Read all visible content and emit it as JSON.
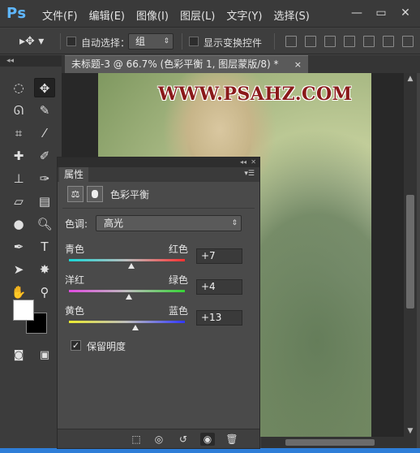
{
  "app": {
    "logo": "Ps"
  },
  "menu": [
    "文件(F)",
    "编辑(E)",
    "图像(I)",
    "图层(L)",
    "文字(Y)",
    "选择(S)"
  ],
  "window_controls": {
    "minimize": "—",
    "restore": "▭",
    "close": "✕"
  },
  "options_bar": {
    "tool_glyph": "▸✥ ▾",
    "auto_select_label": "自动选择：",
    "auto_select_value": "组",
    "show_transform_label": "显示变换控件"
  },
  "document": {
    "tab_title": "未标题-3 @ 66.7% (色彩平衡 1, 图层蒙版/8) *",
    "tab_close": "×",
    "watermark": "WWW.PSAHZ.COM"
  },
  "properties": {
    "tab_label": "属性",
    "adjustment_title": "色彩平衡",
    "tone_label": "色调:",
    "tone_value": "高光",
    "sliders": [
      {
        "left": "青色",
        "right": "红色",
        "value": "+7",
        "fraction": 0.54,
        "colors": [
          "#17d7d7",
          "#ff3030"
        ]
      },
      {
        "left": "洋红",
        "right": "绿色",
        "value": "+4",
        "fraction": 0.52,
        "colors": [
          "#e04ae0",
          "#35d435"
        ]
      },
      {
        "left": "黄色",
        "right": "蓝色",
        "value": "+13",
        "fraction": 0.57,
        "colors": [
          "#ecec30",
          "#3036ff"
        ]
      }
    ],
    "preserve_label": "保留明度",
    "preserve_checked": true,
    "preserve_mark": "✓"
  }
}
